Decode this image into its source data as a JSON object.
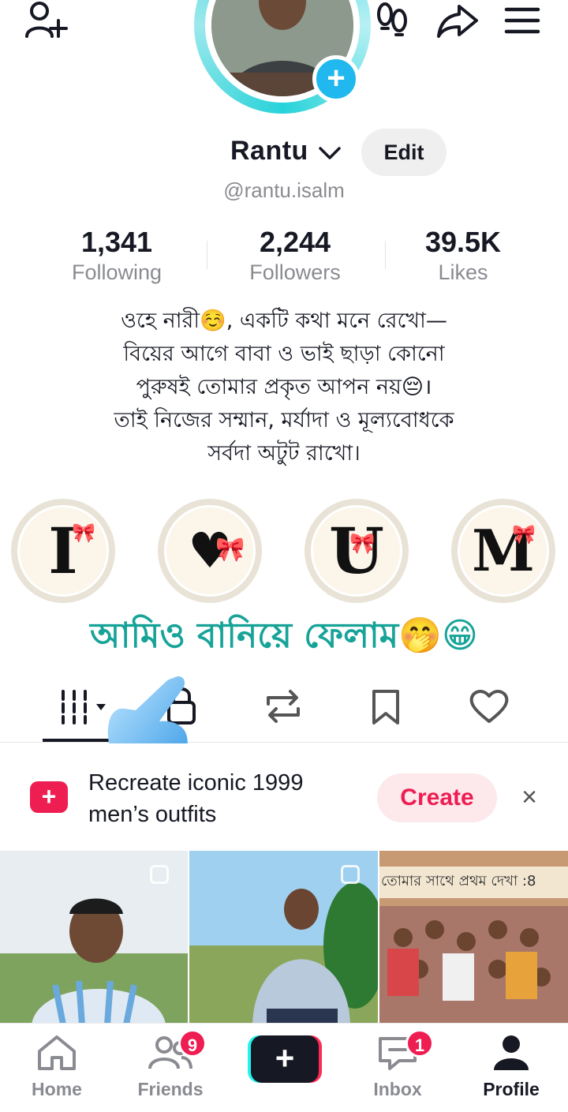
{
  "header": {
    "add_friend_icon": "person-plus-icon",
    "footprints_icon": "footprints-icon",
    "share_icon": "share-arrow-icon",
    "menu_icon": "hamburger-menu-icon"
  },
  "profile": {
    "name": "Rantu",
    "edit_label": "Edit",
    "username": "@rantu.isalm",
    "avatar_plus": "+"
  },
  "stats": [
    {
      "value": "1,341",
      "label": "Following"
    },
    {
      "value": "2,244",
      "label": "Followers"
    },
    {
      "value": "39.5K",
      "label": "Likes"
    }
  ],
  "bio": {
    "lines": [
      "ওহে নারী☺️, একটি কথা মনে রেখো—",
      "বিয়ের আগে বাবা ও ভাই ছাড়া কোনো",
      "পুরুষই তোমার প্রকৃত আপন নয়😔।",
      "তাই নিজের সম্মান, মর্যাদা ও মূল্যবোধকে",
      "সর্বদা অটুট রাখো।"
    ]
  },
  "highlights": [
    {
      "letter": "I",
      "bow": "🎀"
    },
    {
      "letter": "♥",
      "bow": "🎀"
    },
    {
      "letter": "U",
      "bow": "🎀"
    },
    {
      "letter": "M",
      "bow": "🎀"
    }
  ],
  "overlay_caption": "আমিও বানিয়ে ফেলাম🤭😁",
  "promo": {
    "text": "Recreate iconic 1999 men’s outfits",
    "create_label": "Create",
    "close_label": "×"
  },
  "grid": [
    {
      "caption": ""
    },
    {
      "caption": ""
    },
    {
      "caption": "তোমার সাথে প্রথম দেখা :8"
    }
  ],
  "bottom_nav": {
    "home": "Home",
    "friends": "Friends",
    "friends_badge": "9",
    "plus": "+",
    "inbox": "Inbox",
    "inbox_badge": "1",
    "profile": "Profile"
  },
  "colors": {
    "accent_red": "#ee1d52",
    "caption_teal": "#17a398",
    "ring_cyan": "#27d3d9",
    "avatar_plus_blue": "#20b8ee"
  }
}
